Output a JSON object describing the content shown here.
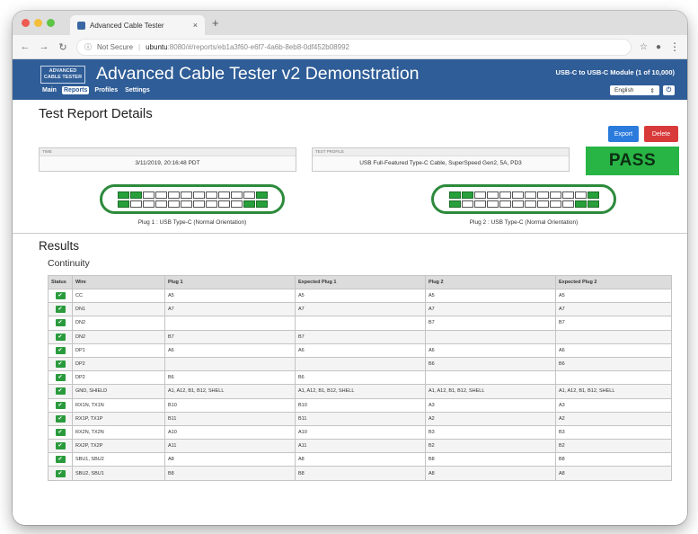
{
  "browser": {
    "tab_title": "Advanced Cable Tester",
    "new_tab": "+",
    "close": "×",
    "security": "Not Secure",
    "url_host": "ubuntu",
    "url_path": ":8080/#/reports/eb1a3f60-e6f7-4a6b-8eb8-0df452b08992"
  },
  "header": {
    "logo": "ADVANCED CABLE TESTER",
    "title": "Advanced Cable Tester v2 Demonstration",
    "module": "USB-C to USB-C Module (1 of 10,000)",
    "language": "English",
    "nav": [
      "Main",
      "Reports",
      "Profiles",
      "Settings"
    ],
    "active_nav": "Reports"
  },
  "report": {
    "title": "Test Report Details",
    "export_label": "Export",
    "delete_label": "Delete",
    "time_label": "TIME",
    "time_value": "3/11/2019, 20:16:48 PDT",
    "profile_label": "TEST PROFILE",
    "profile_value": "USB Full-Featured Type-C Cable, SuperSpeed Gen2, 5A, PD3",
    "result": "PASS",
    "plug1_label": "Plug 1 : USB Type-C (Normal Orientation)",
    "plug2_label": "Plug 2 : USB Type-C (Normal Orientation)",
    "colors": {
      "pass": "#28b545",
      "header": "#2f5d97",
      "export": "#2b7bdc",
      "delete": "#d83a3a"
    }
  },
  "results": {
    "title": "Results",
    "section": "Continuity",
    "columns": [
      "Status",
      "Wire",
      "Plug 1",
      "Expected Plug 1",
      "Plug 2",
      "Expected Plug 2"
    ],
    "rows": [
      [
        "CC",
        "A5",
        "A5",
        "A5",
        "A5"
      ],
      [
        "DN1",
        "A7",
        "A7",
        "A7",
        "A7"
      ],
      [
        "DN2",
        "",
        "",
        "B7",
        "B7"
      ],
      [
        "DN2",
        "B7",
        "B7",
        "",
        ""
      ],
      [
        "DP1",
        "A6",
        "A6",
        "A6",
        "A6"
      ],
      [
        "DP2",
        "",
        "",
        "B6",
        "B6"
      ],
      [
        "DP2",
        "B6",
        "B6",
        "",
        ""
      ],
      [
        "GND, SHIELD",
        "A1, A12, B1, B12, SHELL",
        "A1, A12, B1, B12, SHELL",
        "A1, A12, B1, B12, SHELL",
        "A1, A12, B1, B12, SHELL"
      ],
      [
        "RX1N, TX1N",
        "B10",
        "B10",
        "A3",
        "A3"
      ],
      [
        "RX1P, TX1P",
        "B11",
        "B11",
        "A2",
        "A2"
      ],
      [
        "RX2N, TX2N",
        "A10",
        "A10",
        "B3",
        "B3"
      ],
      [
        "RX2P, TX2P",
        "A11",
        "A11",
        "B2",
        "B2"
      ],
      [
        "SBU1, SBU2",
        "A8",
        "A8",
        "B8",
        "B8"
      ],
      [
        "SBU2, SBU1",
        "B8",
        "B8",
        "A8",
        "A8"
      ]
    ]
  }
}
